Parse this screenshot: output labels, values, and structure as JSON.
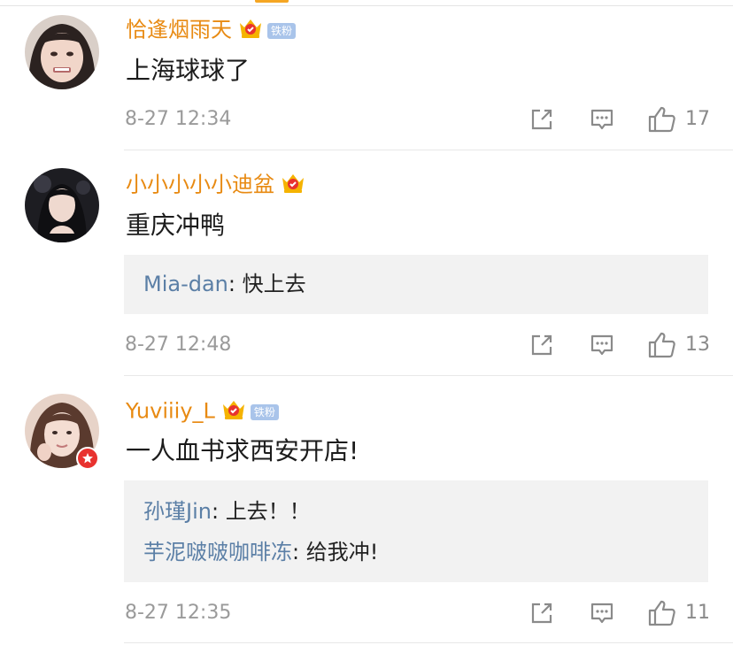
{
  "fan_badge_label": "铁粉",
  "comments": [
    {
      "user": "恰逢烟雨天",
      "text": "上海球球了",
      "time": "8-27 12:34",
      "likes": "17",
      "fan_badge": true,
      "replies": []
    },
    {
      "user": "小小小小小迪盆",
      "text": "重庆冲鸭",
      "time": "8-27 12:48",
      "likes": "13",
      "fan_badge": false,
      "replies": [
        {
          "who": "Mia-dan",
          "sep": ": ",
          "text": "快上去"
        }
      ]
    },
    {
      "user": "Yuviiiy_L",
      "text": "一人血书求西安开店!",
      "time": "8-27 12:35",
      "likes": "11",
      "fan_badge": true,
      "replies": [
        {
          "who": "孙瑾Jin",
          "sep": ": ",
          "text": "上去！！"
        },
        {
          "who": "芋泥啵啵咖啡冻",
          "sep": ": ",
          "text": "给我冲!"
        }
      ]
    }
  ],
  "colors": {
    "username": "#e88a12",
    "reply_name": "#5b7fa6",
    "reply_bg": "#f2f2f2",
    "meta": "#9a9a9a",
    "fan_badge": "#a9c4ea",
    "verified_badge": "#e8322f"
  },
  "icons": [
    "repost-icon",
    "comment-icon",
    "like-icon",
    "vip-crown-icon",
    "verified-star-icon"
  ]
}
